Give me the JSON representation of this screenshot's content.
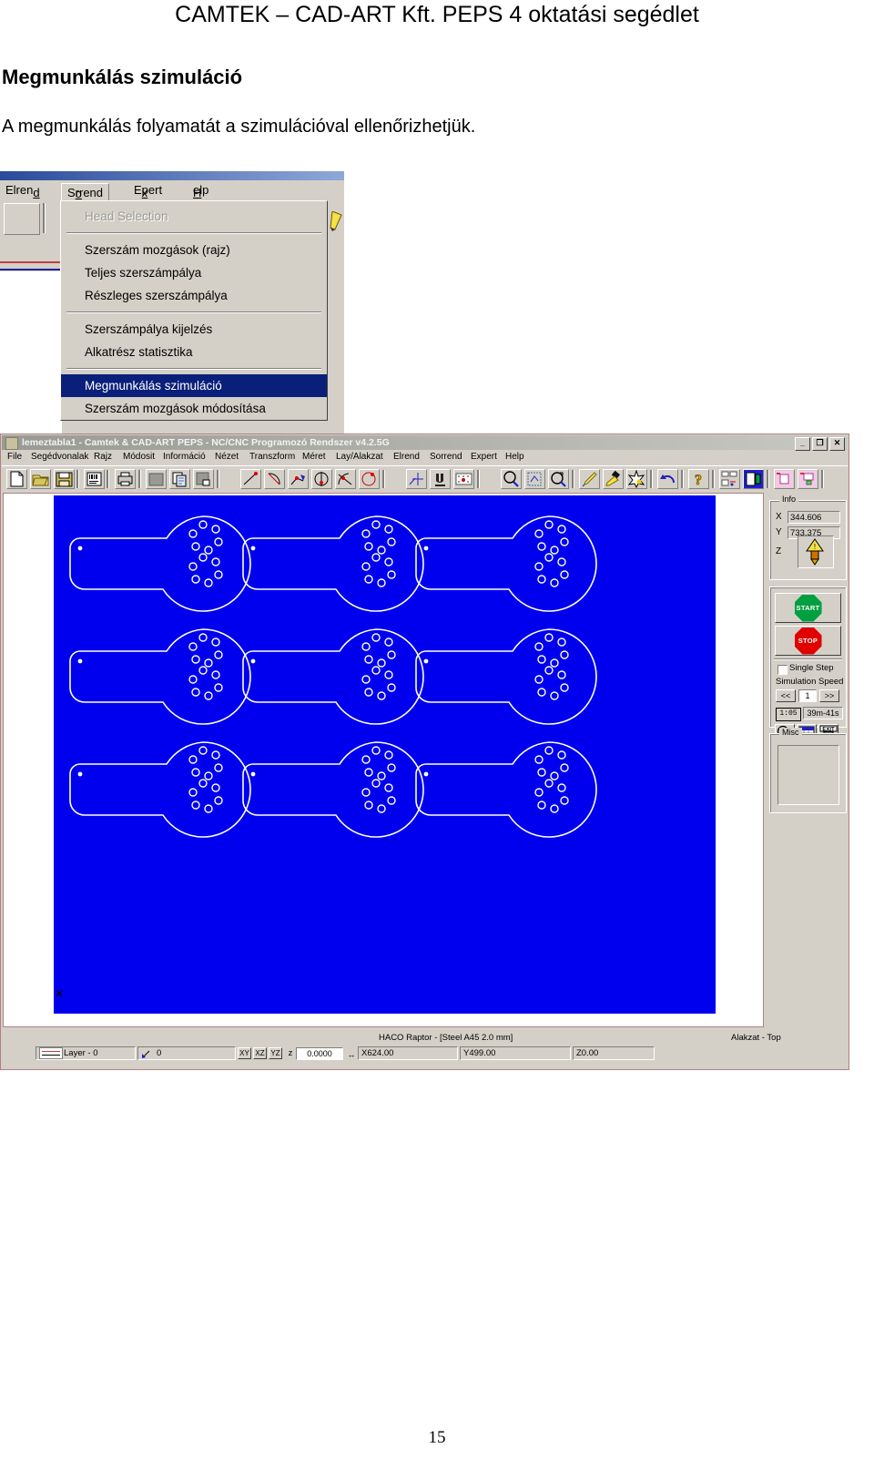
{
  "document": {
    "header": "CAMTEK – CAD-ART Kft. PEPS 4 oktatási segédlet",
    "heading": "Megmunkálás szimuláció",
    "paragraph": "A megmunkálás folyamatát a szimulációval ellenőrizhetjük.",
    "page_number": "15"
  },
  "menu_screenshot": {
    "menubar": [
      {
        "label": "Elrend",
        "accel": "d"
      },
      {
        "label": "Sorrend",
        "accel": "o"
      },
      {
        "label": "Expert",
        "accel": "x"
      },
      {
        "label": "Help",
        "accel": "H"
      }
    ],
    "popup_items": [
      {
        "label": "Head Selection",
        "state": "disabled"
      },
      {
        "label": "SEPARATOR",
        "state": "separator"
      },
      {
        "label": "Szerszám mozgások (rajz)",
        "state": "normal"
      },
      {
        "label": "Teljes szerszámpálya",
        "state": "normal"
      },
      {
        "label": "Részleges szerszámpálya",
        "state": "normal"
      },
      {
        "label": "SEPARATOR",
        "state": "separator"
      },
      {
        "label": "Szerszámpálya kijelzés",
        "state": "normal"
      },
      {
        "label": "Alkatrész statisztika",
        "state": "normal"
      },
      {
        "label": "SEPARATOR",
        "state": "separator"
      },
      {
        "label": "Megmunkálás szimuláció",
        "state": "selected"
      },
      {
        "label": "Szerszám mozgások módosítása",
        "state": "normal"
      }
    ]
  },
  "app": {
    "title": "lemeztabla1 - Camtek & CAD-ART  PEPS - NC/CNC Programozó Rendszer v4.2.5G",
    "window_buttons": [
      {
        "name": "minimize",
        "glyph": "_"
      },
      {
        "name": "restore",
        "glyph": "❐"
      },
      {
        "name": "close",
        "glyph": "✕"
      }
    ],
    "menubar": [
      "File",
      "Segédvonalak",
      "Rajz",
      "Módosit",
      "Információ",
      "Nézet",
      "Transzform",
      "Méret",
      "Lay/Alakzat",
      "Elrend",
      "Sorrend",
      "Expert",
      "Help"
    ],
    "toolbar_icons": [
      "new-file-icon",
      "open-folder-icon",
      "save-disk-icon",
      "barcode-icon",
      "print-icon",
      "page-setup-icon",
      "copy-icon",
      "paste-icon",
      "line-point-icon",
      "arc-icon",
      "polyline-icon",
      "circle-center-icon",
      "tangent-icon",
      "circle-icon",
      "snap-point-icon",
      "insert-node-icon",
      "magnet-icon",
      "grid-snap-icon",
      "zoom-icon",
      "zoom-window-icon",
      "zoom-rotate-icon",
      "paint-brush-icon",
      "highlighter-icon",
      "star-burst-icon",
      "undo-icon",
      "help-question-icon",
      "nest-parts-icon",
      "simulation-icon",
      "layout-pink-icon",
      "layout-pink2-icon"
    ],
    "info_panel": {
      "group_label": "Info",
      "x_label": "X",
      "x_value": "344.606",
      "y_label": "Y",
      "y_value": "733.375",
      "z_label": "Z",
      "z_icon": "tool-head-icon"
    },
    "control_panel": {
      "start_label": "START",
      "start_color": "#00a040",
      "stop_label": "STOP",
      "stop_color": "#e00000",
      "single_step_label": "Single Step",
      "single_step_checked": false,
      "simulation_speed_label": "Simulation Speed",
      "speed_prev": "<<",
      "speed_value": "1",
      "speed_next": ">>",
      "rate_label": "1:05",
      "elapsed_time": "39m-41s",
      "buttons": [
        "zoom-icon",
        "table-icon",
        "exit-icon"
      ]
    },
    "misc_panel": {
      "group_label": "Misc"
    },
    "status_bar": {
      "machine": "HACO Raptor   - [Steel A45 2.0 mm]",
      "shape": "Alakzat - Top",
      "layer": "Layer - 0",
      "angle": "0",
      "planes": [
        "XY",
        "XZ",
        "YZ"
      ],
      "z_label": "z",
      "z_value": "0.0000",
      "x_size": "X624.00",
      "y_size": "Y499.00",
      "z_size": "Z0.00"
    },
    "canvas": {
      "background_color": "#0000ee",
      "outline_color": "#ffffff",
      "parts_rows": 3,
      "parts_cols": 3
    }
  }
}
